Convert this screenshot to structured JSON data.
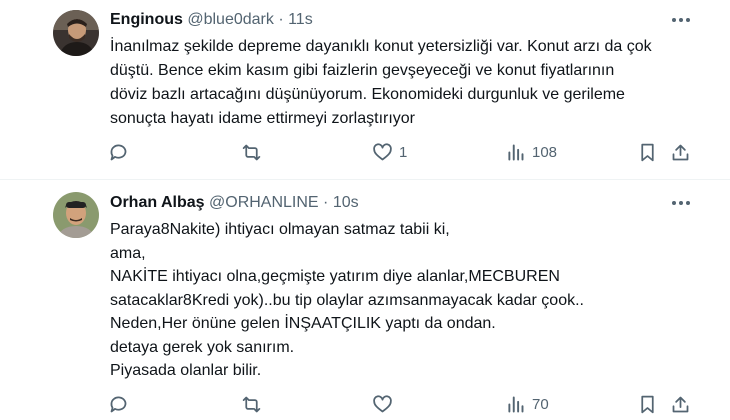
{
  "tweets": [
    {
      "name": "Enginous",
      "handle": "@blue0dark",
      "separator": "·",
      "time": "11s",
      "text": "İnanılmaz şekilde depreme dayanıklı konut yetersizliği var. Konut arzı da çok\ndüştü. Bence ekim kasım gibi faizlerin gevşeyeceği ve konut fiyatlarının\ndöviz bazlı artacağını düşünüyorum. Ekonomideki durgunluk ve gerileme\nsonuçta hayatı idame ettirmeyi zorlaştırıyor",
      "likes": "1",
      "views": "108"
    },
    {
      "name": "Orhan Albaş",
      "handle": "@ORHANLINE",
      "separator": "·",
      "time": "10s",
      "text": "Paraya8Nakite) ihtiyacı olmayan satmaz tabii ki,\nama,\nNAKİTE ihtiyacı olna,geçmişte yatırım diye alanlar,MECBUREN\nsatacaklar8Kredi yok)..bu tip olaylar azımsanmayacak kadar çook..\nNeden,Her önüne gelen İNŞAATÇILIK yaptı da ondan.\ndetaya gerek yok sanırım.\nPiyasada olanlar bilir.",
      "views": "70"
    }
  ],
  "colors": {
    "text": "#0f1419",
    "secondary": "#536471",
    "divider": "#eff3f4"
  }
}
